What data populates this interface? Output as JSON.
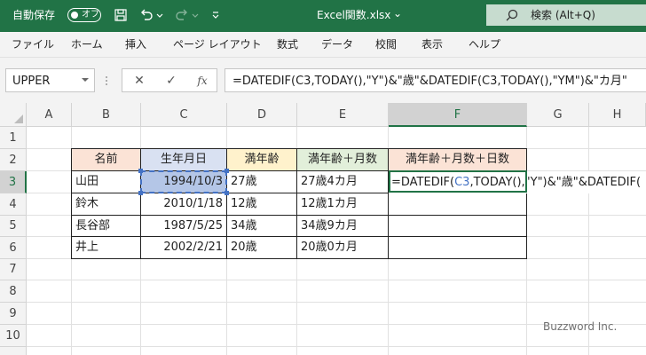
{
  "titlebar": {
    "autosave_label": "自動保存",
    "autosave_state": "オフ",
    "filename": "Excel関数.xlsx",
    "filename_caret": "⌄",
    "search_placeholder": "検索 (Alt+Q)",
    "accent_color": "#217346"
  },
  "menu": [
    "ファイル",
    "ホーム",
    "挿入",
    "ページ レイアウト",
    "数式",
    "データ",
    "校閲",
    "表示",
    "ヘルプ"
  ],
  "formula_bar": {
    "name_box": "UPPER",
    "cancel_symbol": "✕",
    "enter_symbol": "✓",
    "fx_symbol": "fx",
    "formula": "=DATEDIF(C3,TODAY(),\"Y\")&\"歳\"&DATEDIF(C3,TODAY(),\"YM\")&\"カ月\""
  },
  "columns": [
    "A",
    "B",
    "C",
    "D",
    "E",
    "F",
    "G",
    "H"
  ],
  "active_column": "F",
  "rows": [
    "1",
    "2",
    "3",
    "4",
    "5",
    "6",
    "7",
    "8",
    "9",
    "10"
  ],
  "active_row": "3",
  "table": {
    "headers": [
      "名前",
      "生年月日",
      "満年齢",
      "満年齢＋月数",
      "満年齢＋月数＋日数"
    ],
    "header_colors": [
      "#fbe3d6",
      "#d9e1f2",
      "#fff2cc",
      "#e2efda",
      "#fbe3d6"
    ],
    "rows": [
      [
        "山田",
        "1994/10/3",
        "27歳",
        "27歳4カ月",
        ""
      ],
      [
        "鈴木",
        "2010/1/18",
        "12歳",
        "12歳1カ月",
        ""
      ],
      [
        "長谷部",
        "1987/5/25",
        "34歳",
        "34歳9カ月",
        ""
      ],
      [
        "井上",
        "2002/2/21",
        "20歳",
        "20歳0カ月",
        ""
      ]
    ]
  },
  "editing_cell": {
    "prefix": "=DATEDIF(",
    "ref": "C3",
    "suffix": ",TODAY(),\"Y\")&\"歳\"&DATEDIF("
  },
  "watermark": "Buzzword Inc."
}
